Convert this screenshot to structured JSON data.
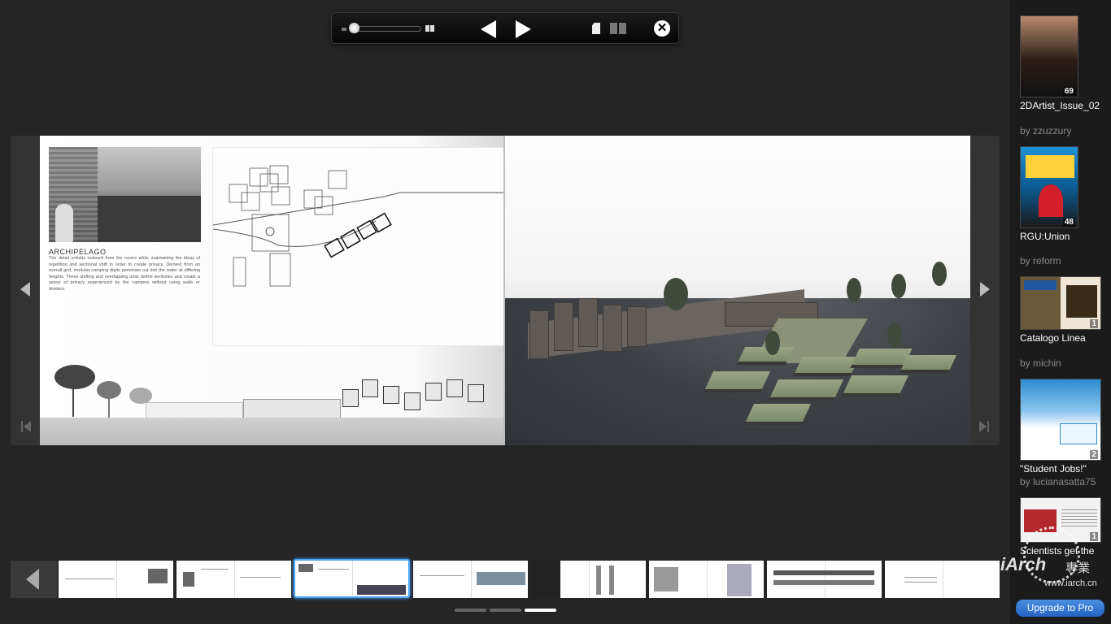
{
  "viewer": {
    "left_page": {
      "heading": "ARCHIPELAGO",
      "body": "The detail unfolds outward from the rooms while maintaining the ideas of repetition and sectional shift in order to create privacy. Derived from an overall grid, modular camping digits penetrate out into the water at differing heights. These shifting and overlapping units define territories and create a sense of privacy experienced by the campers without using walls or dividers."
    }
  },
  "sidebar": {
    "items": [
      {
        "title": "2DArtist_Issue_02",
        "count": "69",
        "by": "by zzuzzury",
        "thumb_color": "#3a2a22"
      },
      {
        "title": "RGU:Union",
        "count": "48",
        "by": "by reform",
        "thumb_color": "#1e90d6"
      },
      {
        "title": "Catalogo Linea",
        "count": "1",
        "by": "by michin",
        "thumb_color": "#6b5a3a"
      },
      {
        "title": "\"Student Jobs!\"",
        "count": "2",
        "by": "by lucianasatta75",
        "thumb_color": "#2d8ccf"
      },
      {
        "title": "Scientists get the",
        "count": "1",
        "by": "",
        "thumb_color": "#f2f2f2"
      }
    ],
    "upgrade_label": "Upgrade to Pro"
  },
  "watermark": {
    "text": "iArch",
    "cn": "專業",
    "url": "www.iarch.cn"
  },
  "colors": {
    "background": "#252525",
    "accent": "#4aa3ff",
    "upgrade": "#2d6fd2"
  },
  "icons": [
    "zoom-out-icon",
    "zoom-in-icon",
    "prev-page-icon",
    "next-page-icon",
    "single-page-icon",
    "double-page-icon",
    "close-icon",
    "first-page-icon",
    "last-page-icon"
  ]
}
